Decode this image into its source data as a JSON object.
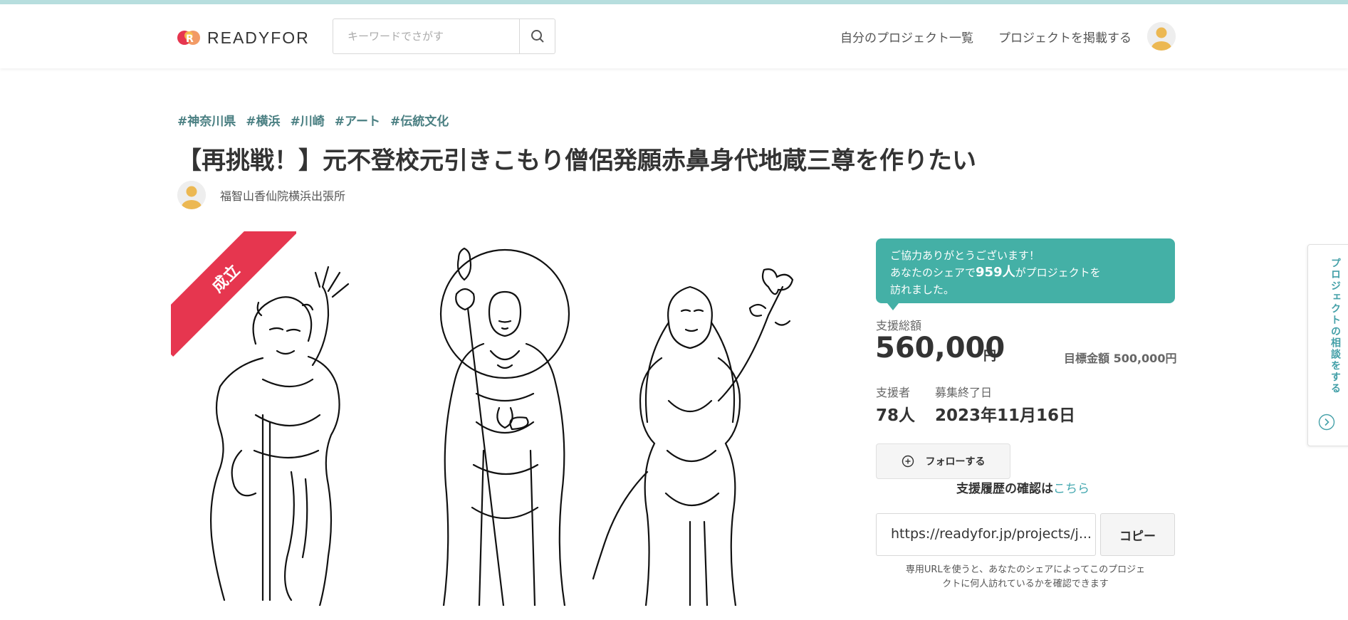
{
  "header": {
    "logo_text": "READYFOR",
    "search_placeholder": "キーワードでさがす",
    "nav_my_projects": "自分のプロジェクト一覧",
    "nav_post_project": "プロジェクトを掲載する"
  },
  "project": {
    "tags": [
      "#神奈川県",
      "#横浜",
      "#川崎",
      "#アート",
      "#伝統文化"
    ],
    "title": "【再挑戦！】元不登校元引きこもり僧侶発願赤鼻身代地蔵三尊を作りたい",
    "owner": "福智山香仙院横浜出張所",
    "ribbon": "成立"
  },
  "support": {
    "thanks_line1": "ご協力ありがとうございます！",
    "thanks_line2_pre": "あなたのシェアで",
    "thanks_count": "959人",
    "thanks_line2_post": "がプロジェクトを",
    "thanks_line3": "訪れました。",
    "total_label": "支援総額",
    "total_amount": "560,000",
    "currency": "円",
    "goal_label": "目標金額 500,000円",
    "backers_label": "支援者",
    "backers_value": "78人",
    "end_label": "募集終了日",
    "end_value": "2023年11月16日",
    "follow_label": "フォローする",
    "history_text": "支援履歴の確認は",
    "history_link": "こちら",
    "share_url": "https://readyfor.jp/projects/j...",
    "copy_label": "コピー",
    "url_note_line1": "専用URLを使うと、あなたのシェアによってこのプロジェ",
    "url_note_line2": "クトに何人訪れているかを確認できます"
  },
  "side_tab": {
    "label": "プロジェクトの相談をする"
  },
  "colors": {
    "accent": "#44b0a6",
    "ribbon": "#e6364f",
    "tag": "#4a7f82",
    "link": "#44a8b0"
  }
}
